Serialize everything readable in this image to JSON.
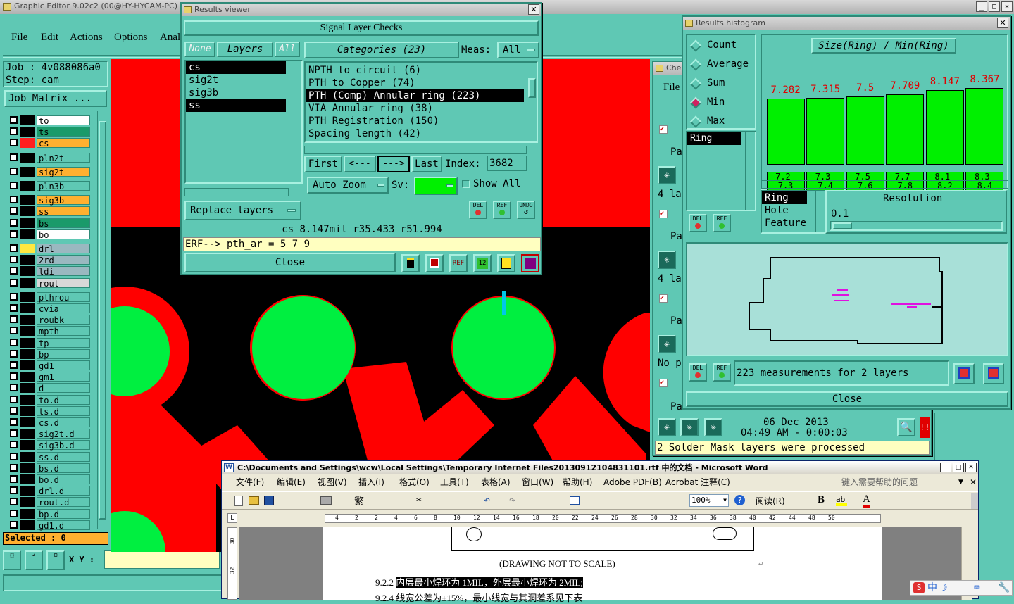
{
  "main_window": {
    "title": "Graphic Editor 9.02c2 (00@HY-HYCAM-PC)",
    "menu": [
      "File",
      "Edit",
      "Actions",
      "Options",
      "Anal"
    ],
    "job_label": "Job : 4v088086a0",
    "step_label": "Step: cam",
    "job_matrix_button": "Job Matrix ...",
    "selected_label": "Selected : 0",
    "xy_label": "X Y :"
  },
  "layers": [
    {
      "name": "to",
      "color": "#ffffff",
      "swatch": "#000000"
    },
    {
      "name": "ts",
      "color": "#1a9a6a",
      "swatch": "#000000"
    },
    {
      "name": "cs",
      "color": "#ffb030",
      "swatch": "#ff2020"
    },
    {
      "name": "pln2t",
      "color": "#5fc8b4",
      "swatch": ""
    },
    {
      "name": "sig2t",
      "color": "#ffb030",
      "swatch": ""
    },
    {
      "name": "pln3b",
      "color": "#5fc8b4",
      "swatch": ""
    },
    {
      "name": "sig3b",
      "color": "#ffb030",
      "swatch": ""
    },
    {
      "name": "ss",
      "color": "#ffb030",
      "swatch": ""
    },
    {
      "name": "bs",
      "color": "#1a9a6a",
      "swatch": ""
    },
    {
      "name": "bo",
      "color": "#ffffff",
      "swatch": ""
    },
    {
      "name": "drl",
      "color": "#9ab8c0",
      "swatch": "#ffe840"
    },
    {
      "name": "2rd",
      "color": "#9ab8c0",
      "swatch": ""
    },
    {
      "name": "ldi",
      "color": "#9ab8c0",
      "swatch": ""
    },
    {
      "name": "rout",
      "color": "#d8d8d8",
      "swatch": ""
    },
    {
      "name": "pthrou",
      "color": "#5fc8b4",
      "swatch": ""
    },
    {
      "name": "cvia",
      "color": "#5fc8b4",
      "swatch": ""
    },
    {
      "name": "roubk",
      "color": "#5fc8b4",
      "swatch": ""
    },
    {
      "name": "mpth",
      "color": "#5fc8b4",
      "swatch": ""
    },
    {
      "name": "tp",
      "color": "#5fc8b4",
      "swatch": ""
    },
    {
      "name": "bp",
      "color": "#5fc8b4",
      "swatch": ""
    },
    {
      "name": "gd1",
      "color": "#5fc8b4",
      "swatch": ""
    },
    {
      "name": "gm1",
      "color": "#5fc8b4",
      "swatch": ""
    },
    {
      "name": "d",
      "color": "#5fc8b4",
      "swatch": ""
    },
    {
      "name": "to.d",
      "color": "#5fc8b4",
      "swatch": ""
    },
    {
      "name": "ts.d",
      "color": "#5fc8b4",
      "swatch": ""
    },
    {
      "name": "cs.d",
      "color": "#5fc8b4",
      "swatch": ""
    },
    {
      "name": "sig2t.d",
      "color": "#5fc8b4",
      "swatch": ""
    },
    {
      "name": "sig3b.d",
      "color": "#5fc8b4",
      "swatch": ""
    },
    {
      "name": "ss.d",
      "color": "#5fc8b4",
      "swatch": ""
    },
    {
      "name": "bs.d",
      "color": "#5fc8b4",
      "swatch": ""
    },
    {
      "name": "bo.d",
      "color": "#5fc8b4",
      "swatch": ""
    },
    {
      "name": "drl.d",
      "color": "#5fc8b4",
      "swatch": ""
    },
    {
      "name": "rout.d",
      "color": "#5fc8b4",
      "swatch": ""
    },
    {
      "name": "bp.d",
      "color": "#5fc8b4",
      "swatch": ""
    },
    {
      "name": "gd1.d",
      "color": "#5fc8b4",
      "swatch": ""
    }
  ],
  "results_viewer": {
    "title": "Results viewer",
    "header": "Signal Layer Checks",
    "none_btn": "None",
    "layers_btn": "Layers",
    "all_btn": "All",
    "categories_btn": "Categories (23)",
    "meas_label": "Meas:",
    "meas_value": "All",
    "layer_items": [
      "cs",
      "sig2t",
      "sig3b",
      "ss"
    ],
    "categories": [
      "NPTH to circuit (6)",
      "PTH to Copper (74)",
      "PTH (Comp) Annular ring (223)",
      "VIA Annular ring (38)",
      "PTH Registration (150)",
      "Spacing length (42)"
    ],
    "first_btn": "First",
    "prev_btn": "<---",
    "next_btn": "--->",
    "last_btn": "Last",
    "index_label": "Index:",
    "index_value": "3682",
    "auto_zoom": "Auto Zoom",
    "sv_label": "Sv:",
    "show_all": "Show All",
    "replace_layers": "Replace layers",
    "status": "cs 8.147mil  r35.433  r51.994",
    "erf": "ERF--> pth_ar = 5 7 9",
    "close_btn": "Close",
    "del": "DEL",
    "ref": "REF",
    "undo": "UNDO"
  },
  "histogram": {
    "title": "Results histogram",
    "radio_options": [
      "Count",
      "Average",
      "Sum",
      "Min",
      "Max"
    ],
    "selected_radio": "Min",
    "chart_title": "Size(Ring) / Min(Ring)",
    "values": [
      "7.282",
      "7.315",
      "7.5",
      "7.709",
      "8.147",
      "8.367"
    ],
    "ranges": [
      [
        "7.2-",
        "7.3"
      ],
      [
        "7.3-",
        "7.4"
      ],
      [
        "7.5-",
        "7.6"
      ],
      [
        "7.7-",
        "7.8"
      ],
      [
        "8.1-",
        "8.2"
      ],
      [
        "8.3-",
        "8.4"
      ]
    ],
    "ring_item": "Ring",
    "feature_list": [
      "Ring",
      "Hole",
      "Feature"
    ],
    "resolution_label": "Resolution",
    "resolution_value": "0.1",
    "measurements": "223 measurements for 2 layers",
    "close_btn": "Close",
    "del": "DEL",
    "ref": "REF"
  },
  "checklist_window": {
    "title": "Che",
    "file_menu": "File",
    "pa_labels": [
      "Pa",
      "Pa",
      "Pa",
      "Pa"
    ],
    "la_labels": [
      "4 la",
      "4 la",
      "No p"
    ],
    "date": "06 Dec 2013",
    "time": "04:49 AM - 0:00:03",
    "status": "2 Solder Mask layers were processed"
  },
  "word": {
    "title": "C:\\Documents and Settings\\wcw\\Local Settings\\Temporary Internet Files20130912104831101.rtf 中的文档 - Microsoft Word",
    "menu": [
      "文件(F)",
      "编辑(E)",
      "视图(V)",
      "插入(I)",
      "格式(O)",
      "工具(T)",
      "表格(A)",
      "窗口(W)",
      "帮助(H)",
      "Adobe PDF(B)",
      "Acrobat 注释(C)"
    ],
    "help_placeholder": "键入需要帮助的问题",
    "zoom": "100%",
    "read_btn": "阅读(R)",
    "drawing_note": "(DRAWING NOT TO SCALE)",
    "line1_num": "9.2.2",
    "line1_text": "内层最小焊环为 1MIL，外层最小焊环为 2MIL;",
    "line2_text": "9.2.4 线宽公差为±15%，最小线宽与其洞差系见下表",
    "ruler": [
      "4",
      "2",
      "2",
      "4",
      "6",
      "8",
      "10",
      "12",
      "14",
      "16",
      "18",
      "20",
      "22",
      "24",
      "26",
      "28",
      "30",
      "32",
      "34",
      "36",
      "38",
      "40",
      "42",
      "44",
      "48",
      "50"
    ]
  },
  "taskbar_ime": "中"
}
